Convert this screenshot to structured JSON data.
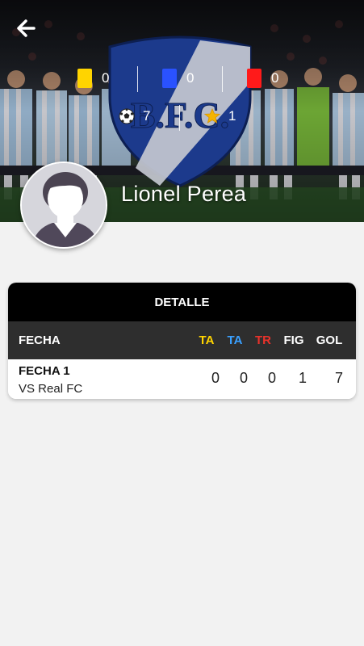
{
  "colors": {
    "yellow_card": "#ffd400",
    "blue_card": "#2a52ff",
    "red_card": "#ff1a1a",
    "ta_header": "#ffd400",
    "taz_header": "#3aa0ff",
    "tr_header": "#e8322b",
    "crest_blue": "#1c3a8c",
    "background": "#f2f2f2"
  },
  "header": {
    "back_icon": "arrow-left-icon",
    "crest_text": "B.F.C."
  },
  "stats": {
    "yellow_cards": "0",
    "blue_cards": "0",
    "red_cards": "0",
    "goals": "7",
    "figures": "1",
    "goals_icon": "soccer-ball-icon",
    "figures_icon": "star-icon"
  },
  "player": {
    "name": "Lionel Perea",
    "avatar_icon": "default-avatar-icon"
  },
  "detail": {
    "title": "DETALLE",
    "columns": {
      "fecha": "FECHA",
      "ta": "TA",
      "taz": "TA",
      "tr": "TR",
      "fig": "FIG",
      "gol": "GOL"
    },
    "rows": [
      {
        "fecha": "FECHA 1",
        "rival": "VS Real FC",
        "ta": "0",
        "taz": "0",
        "tr": "0",
        "fig": "1",
        "gol": "7"
      }
    ]
  }
}
